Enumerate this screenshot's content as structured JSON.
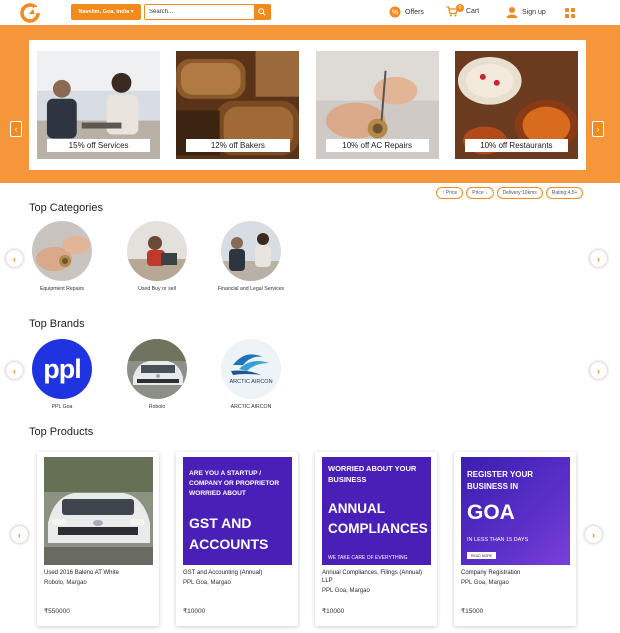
{
  "header": {
    "location_label": "Navelim, Goa, India",
    "search_placeholder": "Search...",
    "offers_label": "Offers",
    "cart_label": "Cart",
    "cart_count": "0",
    "signup_label": "Sign up"
  },
  "hero": {
    "promos": [
      {
        "label": "15% off Services"
      },
      {
        "label": "12% off Bakers"
      },
      {
        "label": "10% off AC Repairs"
      },
      {
        "label": "10% off Restaurants"
      }
    ]
  },
  "filters": [
    "↑ Price",
    "Price ↓",
    "Delivery:10kms",
    "Rating:4.5+"
  ],
  "categories": {
    "title": "Top Categories",
    "items": [
      {
        "label": "Equipment Repairs"
      },
      {
        "label": "Used Buy or sell"
      },
      {
        "label": "Financial and Legal Services"
      }
    ]
  },
  "brands": {
    "title": "Top Brands",
    "items": [
      {
        "label": "PPL Goa",
        "logo_text": "ppl"
      },
      {
        "label": "Robolo"
      },
      {
        "label": "ARCTIC AIRCON",
        "logo_text": "ARCTIC AIRCON"
      }
    ]
  },
  "products": {
    "title": "Top Products",
    "items": [
      {
        "name": "Used 2016 Baleno AT White",
        "seller": "Robolo, Margao",
        "price": "₹550000"
      },
      {
        "name": "GST and Accounting (Annual)",
        "seller": "PPL Goa, Margao",
        "price": "₹10000",
        "img_small": "ARE YOU A STARTUP / COMPANY OR PROPRIETOR WORRIED ABOUT",
        "img_big": "GST AND ACCOUNTS"
      },
      {
        "name": "Annual Compliances, Filings (Annual) LLP",
        "seller": "PPL Goa, Margao",
        "price": "₹10000",
        "img_small": "WORRIED ABOUT YOUR BUSINESS",
        "img_big": "ANNUAL COMPLIANCES",
        "img_foot": "WE TAKE CARE OF EVERYTHING"
      },
      {
        "name": "Company Registration",
        "seller": "PPL Goa, Margao",
        "price": "₹15000",
        "img_small": "REGISTER YOUR BUSINESS IN",
        "img_big": "GOA",
        "img_foot": "IN LESS THAN 15 DAYS",
        "img_btn": "READ MORE"
      }
    ]
  },
  "colors": {
    "accent": "#f28a1c",
    "hero_bg": "#f5963a",
    "product_purple": "#4a1fb8"
  }
}
